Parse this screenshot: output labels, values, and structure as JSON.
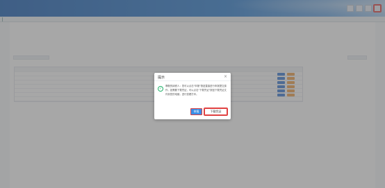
{
  "colors": {
    "topbar_primary": "#1a5fb4",
    "dialog_success": "#21b36b",
    "confirm_blue": "#3a8ee6",
    "highlight_red": "#e04040",
    "op_blue": "#3a7bd5",
    "op_orange": "#f0a04b"
  },
  "topbar": {
    "buttons": [
      {
        "label": "",
        "icon": "",
        "highlighted": false
      },
      {
        "label": "",
        "icon": "",
        "highlighted": false
      },
      {
        "label": "",
        "icon": "",
        "highlighted": false
      },
      {
        "label": "",
        "icon": "",
        "highlighted": true
      }
    ]
  },
  "page": {
    "title": ""
  },
  "dialog": {
    "title": "提示",
    "close_icon": "close-icon",
    "status_icon": "check-circle-icon",
    "message": "尊敬的纳税人：您可以点击\"申报\"按钮直接进行申报提交操作，如需要下载凭证，可以点击\"下载凭证\"按钮下载凭证文件到您的电脑，进行查看打印。",
    "confirm_label": "申报",
    "download_label": "下载凭证"
  }
}
